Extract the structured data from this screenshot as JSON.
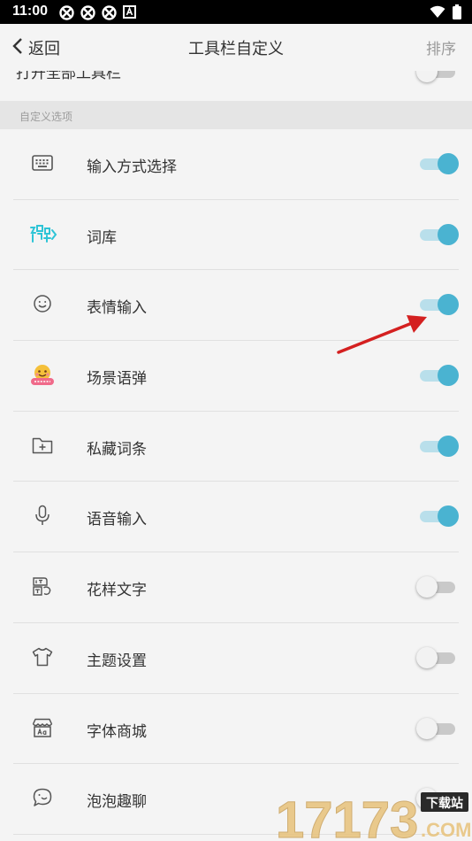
{
  "status_bar": {
    "time": "11:00"
  },
  "header": {
    "back_label": "返回",
    "title": "工具栏自定义",
    "sort_label": "排序"
  },
  "partial_row": {
    "label": "打开全部工具栏"
  },
  "section": {
    "title": "自定义选项"
  },
  "items": [
    {
      "label": "输入方式选择",
      "icon": "keyboard-icon",
      "enabled": true
    },
    {
      "label": "词库",
      "icon": "ciku-logo-icon",
      "enabled": true
    },
    {
      "label": "表情输入",
      "icon": "smiley-icon",
      "enabled": true
    },
    {
      "label": "场景语弹",
      "icon": "scene-emoji-icon",
      "enabled": true
    },
    {
      "label": "私藏词条",
      "icon": "folder-plus-icon",
      "enabled": true
    },
    {
      "label": "语音输入",
      "icon": "microphone-icon",
      "enabled": true
    },
    {
      "label": "花样文字",
      "icon": "fancy-text-icon",
      "enabled": false
    },
    {
      "label": "主题设置",
      "icon": "tshirt-icon",
      "enabled": false
    },
    {
      "label": "字体商城",
      "icon": "font-store-icon",
      "enabled": false
    },
    {
      "label": "泡泡趣聊",
      "icon": "bubble-chat-icon",
      "enabled": false
    }
  ],
  "watermark": {
    "text": "17173",
    "badge": "下载站",
    "suffix": ".COM"
  },
  "colors": {
    "accent": "#4ab3d1",
    "arrow": "#d42020"
  }
}
